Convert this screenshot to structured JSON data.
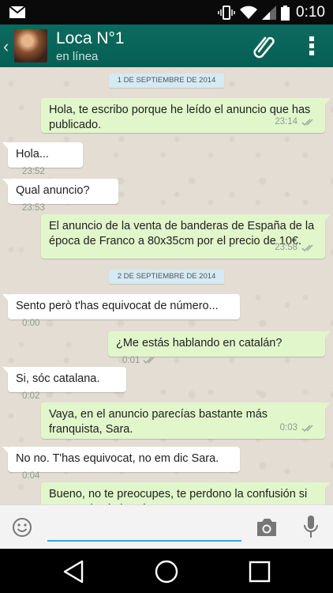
{
  "status_bar": {
    "time": "0:10"
  },
  "header": {
    "contact_name": "Loca N°1",
    "presence": "en línea"
  },
  "messages": [
    {
      "kind": "date",
      "text": "1 DE SEPTIEMBRE DE 2014"
    },
    {
      "kind": "out",
      "text": "Hola, te escribo porque he leído el anuncio que has publicado.",
      "time": "23:14"
    },
    {
      "kind": "in",
      "text": "Hola...",
      "time": "23:52"
    },
    {
      "kind": "in",
      "text": "Qual anuncio?",
      "time": "23:53"
    },
    {
      "kind": "out",
      "text": "El anuncio de la venta de banderas de España de la época de Franco a 80x35cm por el precio de 10€.",
      "time": "23:58"
    },
    {
      "kind": "date",
      "text": "2 DE SEPTIEMBRE DE 2014"
    },
    {
      "kind": "in",
      "text": "Sento però t'has equivocat de número...",
      "time": "0:00"
    },
    {
      "kind": "out",
      "text": "¿Me estás hablando en catalán?",
      "time": "0:01"
    },
    {
      "kind": "in",
      "text": "Si, sóc catalana.",
      "time": "0:02"
    },
    {
      "kind": "out",
      "text": "Vaya, en el anuncio parecías bastante más franquista, Sara.",
      "time": "0:03"
    },
    {
      "kind": "in",
      "text": "No no. T'has equivocat, no em dic Sara.",
      "time": "0:04"
    },
    {
      "kind": "out",
      "text": "Bueno, no te preocupes, te perdono la confusión si me vendes la bandera",
      "time": ""
    }
  ],
  "input": {
    "value": "",
    "placeholder": ""
  },
  "colors": {
    "header": "#075e54",
    "outgoing_bubble": "#e1f7cb",
    "incoming_bubble": "#ffffff",
    "date_chip": "#d4eaf4",
    "input_underline": "#3aa4d6"
  },
  "icons": [
    "mail-icon",
    "vibrate-icon",
    "wifi-icon",
    "signal-icon",
    "battery-icon",
    "back-chevron-icon",
    "paperclip-icon",
    "more-vert-icon",
    "emoji-icon",
    "camera-icon",
    "mic-icon",
    "nav-back-icon",
    "nav-home-icon",
    "nav-recents-icon",
    "double-check-icon"
  ]
}
